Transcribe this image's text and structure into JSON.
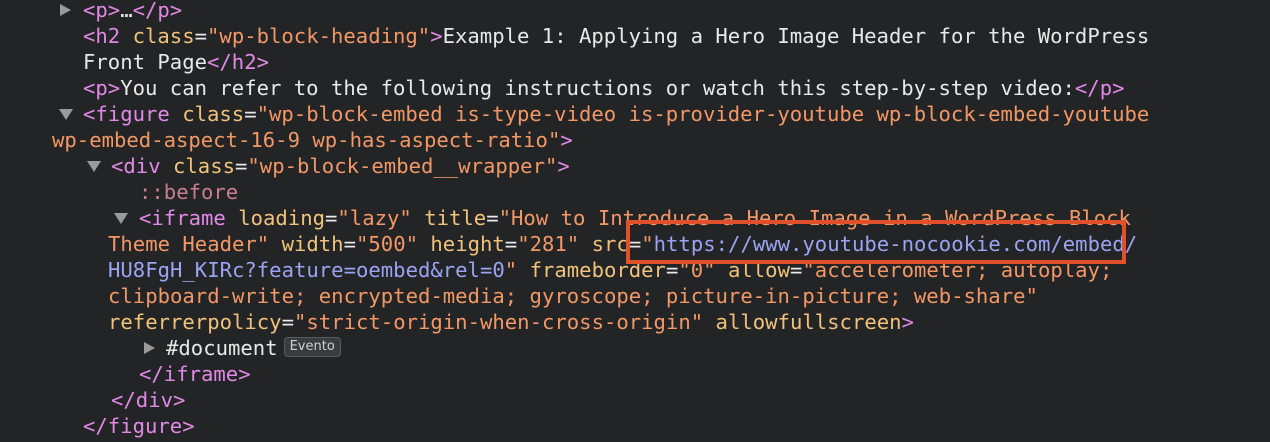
{
  "lines": {
    "l0": {
      "open": "<p>",
      "ellipsis": "…",
      "close": "</p>"
    },
    "l1": {
      "open": "<h2 ",
      "attr": "class",
      "eq": "=",
      "val": "\"wp-block-heading\"",
      "gt": ">",
      "text": "Example 1: Applying a Hero Image Header for the WordPress"
    },
    "l2": {
      "text": "Front Page",
      "close": "</h2>"
    },
    "l3": {
      "open": "<p>",
      "text": "You can refer to the following instructions or watch this step-by-step video:",
      "close": "</p>"
    },
    "l4": {
      "open": "<figure ",
      "attr": "class",
      "eq": "=",
      "val": "\"wp-block-embed is-type-video is-provider-youtube wp-block-embed-youtube"
    },
    "l5": {
      "val": "wp-embed-aspect-16-9 wp-has-aspect-ratio\"",
      "gt": ">"
    },
    "l6": {
      "open": "<div ",
      "attr": "class",
      "eq": "=",
      "val": "\"wp-block-embed__wrapper\"",
      "gt": ">"
    },
    "l7": {
      "pseudo": "::before"
    },
    "l8": {
      "open": "<iframe ",
      "a1": "loading",
      "eq1": "=",
      "v1": "\"lazy\"",
      "a2": " title",
      "eq2": "=",
      "v2": "\"How to Introduce a Hero Image in a WordPress Block"
    },
    "l9": {
      "v2b": "Theme Header\"",
      "a3": " width",
      "eq3": "=",
      "v3": "\"500\"",
      "a4": " height",
      "eq4": "=",
      "v4": "\"281\"",
      "a5": " src",
      "eq5": "=",
      "q5": "\"",
      "link1": "https://www.youtube-nocookie.com/embed/"
    },
    "l10": {
      "link2": "HU8FgH_KIRc?feature=oembed&rel=0",
      "q5b": "\"",
      "a6": " frameborder",
      "eq6": "=",
      "v6": "\"0\"",
      "a7": " allow",
      "eq7": "=",
      "v7": "\"accelerometer; autoplay;"
    },
    "l11": {
      "v7b": "clipboard-write; encrypted-media; gyroscope; picture-in-picture; web-share\""
    },
    "l12": {
      "a8": "referrerpolicy",
      "eq8": "=",
      "v8": "\"strict-origin-when-cross-origin\"",
      "a9": " allowfullscreen",
      "gt": ">"
    },
    "l13": {
      "text": "#document",
      "badge": "Evento"
    },
    "l14": {
      "close": "</iframe>"
    },
    "l15": {
      "close": "</div>"
    },
    "l16": {
      "close": "</figure>"
    }
  }
}
